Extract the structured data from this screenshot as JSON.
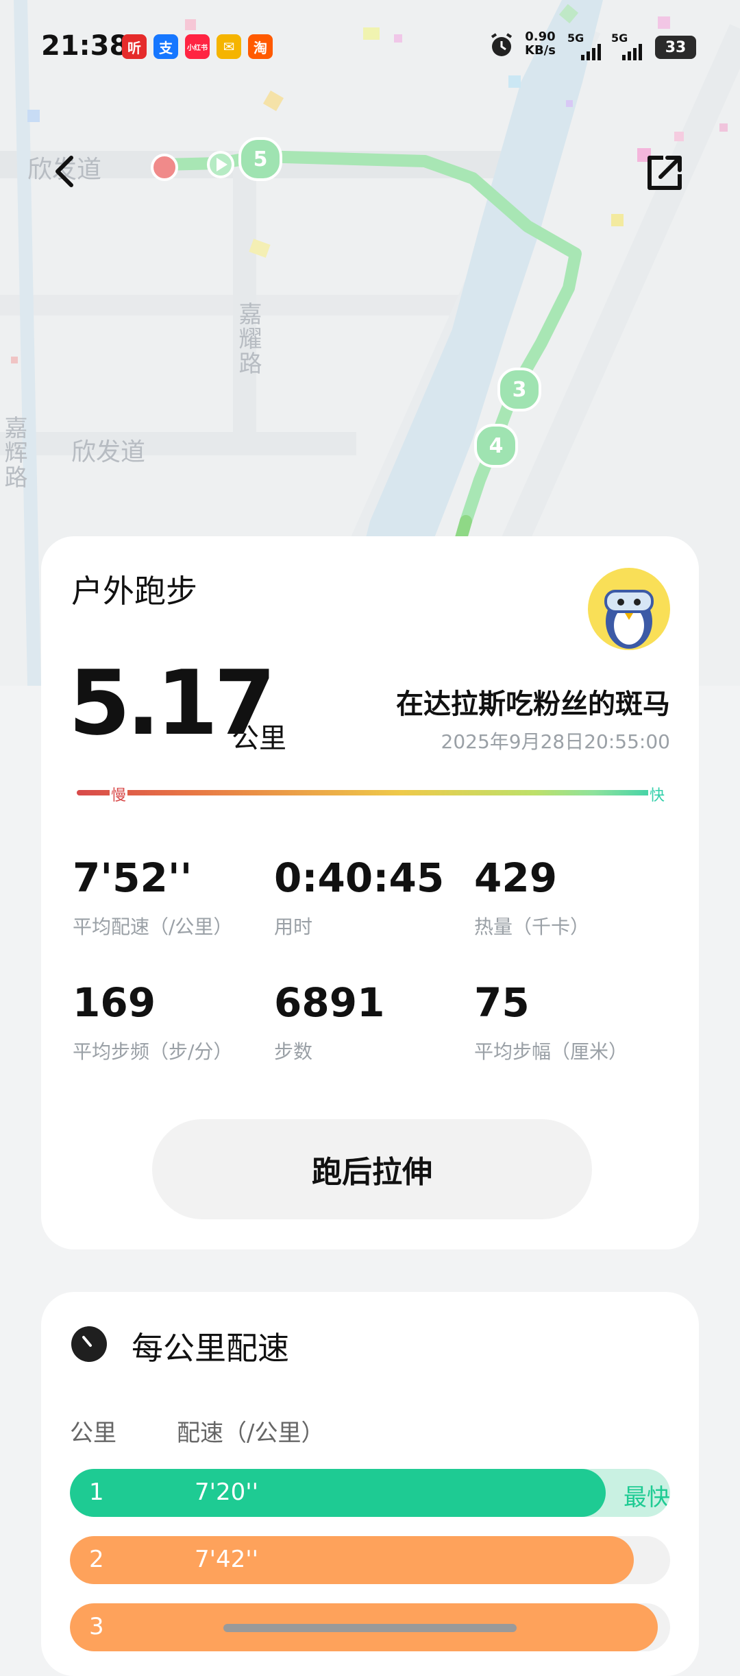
{
  "status_bar": {
    "time": "21:38",
    "apps": [
      {
        "icon": "ting-app-icon",
        "glyph": "听",
        "color": "#e52b2b"
      },
      {
        "icon": "alipay-app-icon",
        "glyph": "支",
        "color": "#1677ff"
      },
      {
        "icon": "xiaohongshu-app-icon",
        "glyph": "小红书",
        "color": "#ff2442"
      },
      {
        "icon": "mail-app-icon",
        "glyph": "✉",
        "color": "#f5b400"
      },
      {
        "icon": "taobao-app-icon",
        "glyph": "淘",
        "color": "#ff5a00"
      }
    ],
    "net_speed_value": "0.90",
    "net_speed_unit": "KB/s",
    "signal_1": "5G",
    "signal_2": "5G",
    "battery": "33"
  },
  "map": {
    "labels": [
      "欣发道",
      "嘉耀路",
      "嘉辉路",
      "欣发道"
    ],
    "km_markers": [
      "5",
      "3",
      "4"
    ],
    "route_color": "#8fe0a6"
  },
  "summary": {
    "title": "户外跑步",
    "distance": "5.17",
    "distance_unit": "公里",
    "user_name": "在达拉斯吃粉丝的斑马",
    "datetime": "2025年9月28日20:55:00",
    "pace_scale": {
      "slow": "慢",
      "fast": "快"
    },
    "stats": [
      {
        "value": "7'52''",
        "label": "平均配速（/公里）"
      },
      {
        "value": "0:40:45",
        "label": "用时"
      },
      {
        "value": "429",
        "label": "热量（千卡）"
      },
      {
        "value": "169",
        "label": "平均步频（步/分）"
      },
      {
        "value": "6891",
        "label": "步数"
      },
      {
        "value": "75",
        "label": "平均步幅（厘米）"
      }
    ],
    "stretch_button": "跑后拉伸"
  },
  "pace_section": {
    "title": "每公里配速",
    "col_km": "公里",
    "col_pace": "配速（/公里）",
    "rows": [
      {
        "km": "1",
        "pace": "7'20''",
        "fraction": 0.893,
        "color": "#1ecb93",
        "tag": "最快",
        "tag_color": "#1ecb93"
      },
      {
        "km": "2",
        "pace": "7'42''",
        "fraction": 0.939,
        "color": "#fea25b",
        "tag": "",
        "tag_color": ""
      },
      {
        "km": "3",
        "pace": "",
        "fraction": 0.98,
        "color": "#fea25b",
        "tag": "",
        "tag_color": ""
      }
    ]
  }
}
